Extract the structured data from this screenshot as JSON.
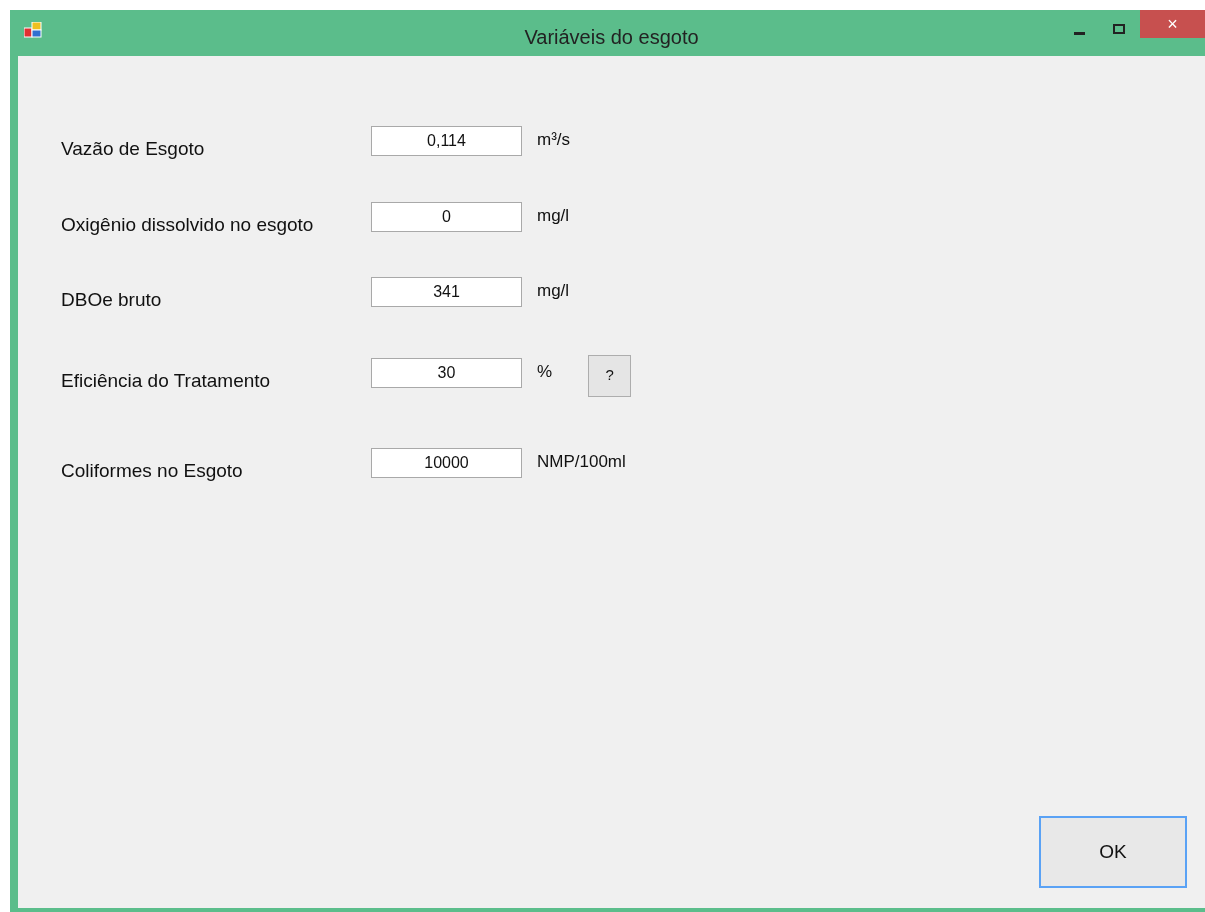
{
  "window": {
    "title": "Variáveis do esgoto",
    "close_label": "×"
  },
  "rows": [
    {
      "label": "Vazão de Esgoto",
      "value": "0,114",
      "unit": "m³/s"
    },
    {
      "label": "Oxigênio dissolvido no esgoto",
      "value": "0",
      "unit": "mg/l"
    },
    {
      "label": "DBOe bruto",
      "value": "341",
      "unit": "mg/l"
    },
    {
      "label": "Eficiência do Tratamento",
      "value": "30",
      "unit": "%",
      "help_button": "?"
    },
    {
      "label": "Coliformes no Esgoto",
      "value": "10000",
      "unit": "NMP/100ml"
    }
  ],
  "ok_button": {
    "label": "OK",
    "focused": true
  }
}
